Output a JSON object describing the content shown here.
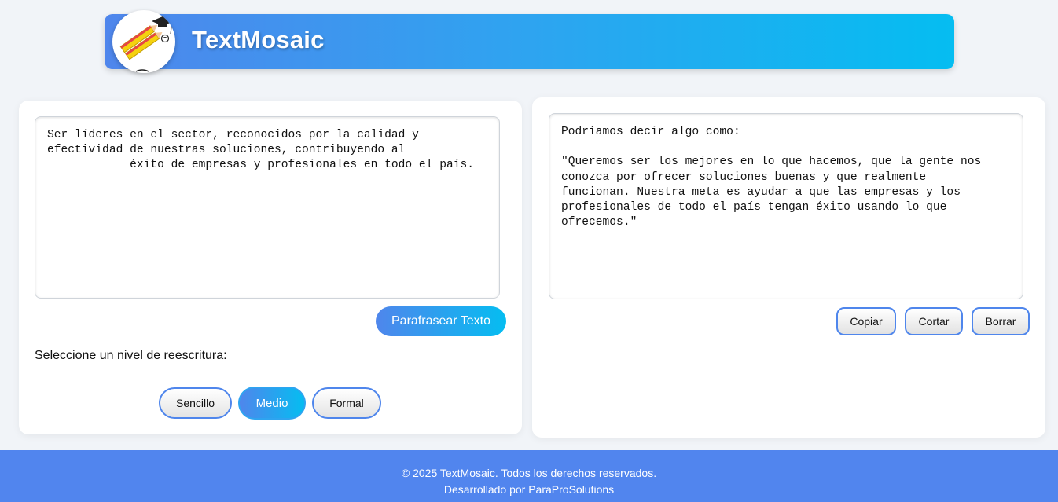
{
  "header": {
    "title": "TextMosaic",
    "logo_icon": "graduation-pencil-logo-icon"
  },
  "input": {
    "text": "Ser líderes en el sector, reconocidos por la calidad y\nefectividad de nuestras soluciones, contribuyendo al\n            éxito de empresas y profesionales en todo el país."
  },
  "actions": {
    "paraphrase_label": "Parafrasear Texto"
  },
  "levels": {
    "label": "Seleccione un nivel de reescritura:",
    "options": [
      "Sencillo",
      "Medio",
      "Formal"
    ],
    "selected": "Medio"
  },
  "output": {
    "text": "Podríamos decir algo como:\n\n\"Queremos ser los mejores en lo que hacemos, que la gente nos\nconozca por ofrecer soluciones buenas y que realmente\nfuncionan. Nuestra meta es ayudar a que las empresas y los\nprofesionales de todo el país tengan éxito usando lo que\nofrecemos.\""
  },
  "output_actions": {
    "copy_label": "Copiar",
    "cut_label": "Cortar",
    "clear_label": "Borrar"
  },
  "footer": {
    "copyright": "© 2025 TextMosaic. Todos los derechos reservados.",
    "developer": "Desarrollado por ParaProSolutions"
  },
  "colors": {
    "accent_start": "#4f86ec",
    "accent_end": "#05bdf1",
    "footer_bg": "#5185ee",
    "page_bg": "#f1f4f8"
  }
}
